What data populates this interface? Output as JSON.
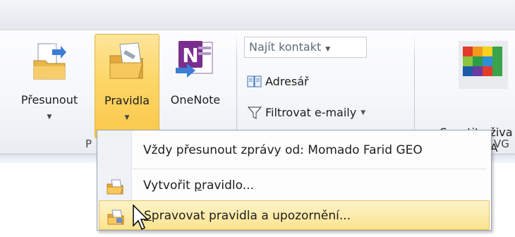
{
  "ribbon": {
    "buttons": [
      {
        "label": "Přesunout",
        "icon": "move-folder-icon"
      },
      {
        "label": "Pravidla",
        "icon": "rules-folder-icon",
        "active": true
      },
      {
        "label": "OneNote",
        "icon": "onenote-icon"
      }
    ],
    "group_label_left": "P",
    "find": {
      "search_placeholder": "Najít kontakt",
      "address_book_label": "Adresář",
      "filter_label": "Filtrovat e-maily"
    },
    "avg": {
      "label_line1": "Spustit uživa",
      "label_line2": "rozhraní A",
      "group_label_fragment": "VG"
    }
  },
  "menu": {
    "items": [
      {
        "label": "Vždy přesunout zprávy od: Momado Farid GEO",
        "icon": null
      },
      {
        "label_before": "Vytvořit ",
        "label_access": "p",
        "label_after": "ravidlo...",
        "icon": "new-rule-icon"
      },
      {
        "label_before": "",
        "label_access": "S",
        "label_after": "pravovat pravidla a upozornění...",
        "icon": "manage-rules-icon",
        "highlighted": true
      }
    ]
  },
  "colors": {
    "active_button": "#fcd667",
    "menu_hover": "#fbe38e",
    "onenote_purple": "#7a2e8e"
  }
}
